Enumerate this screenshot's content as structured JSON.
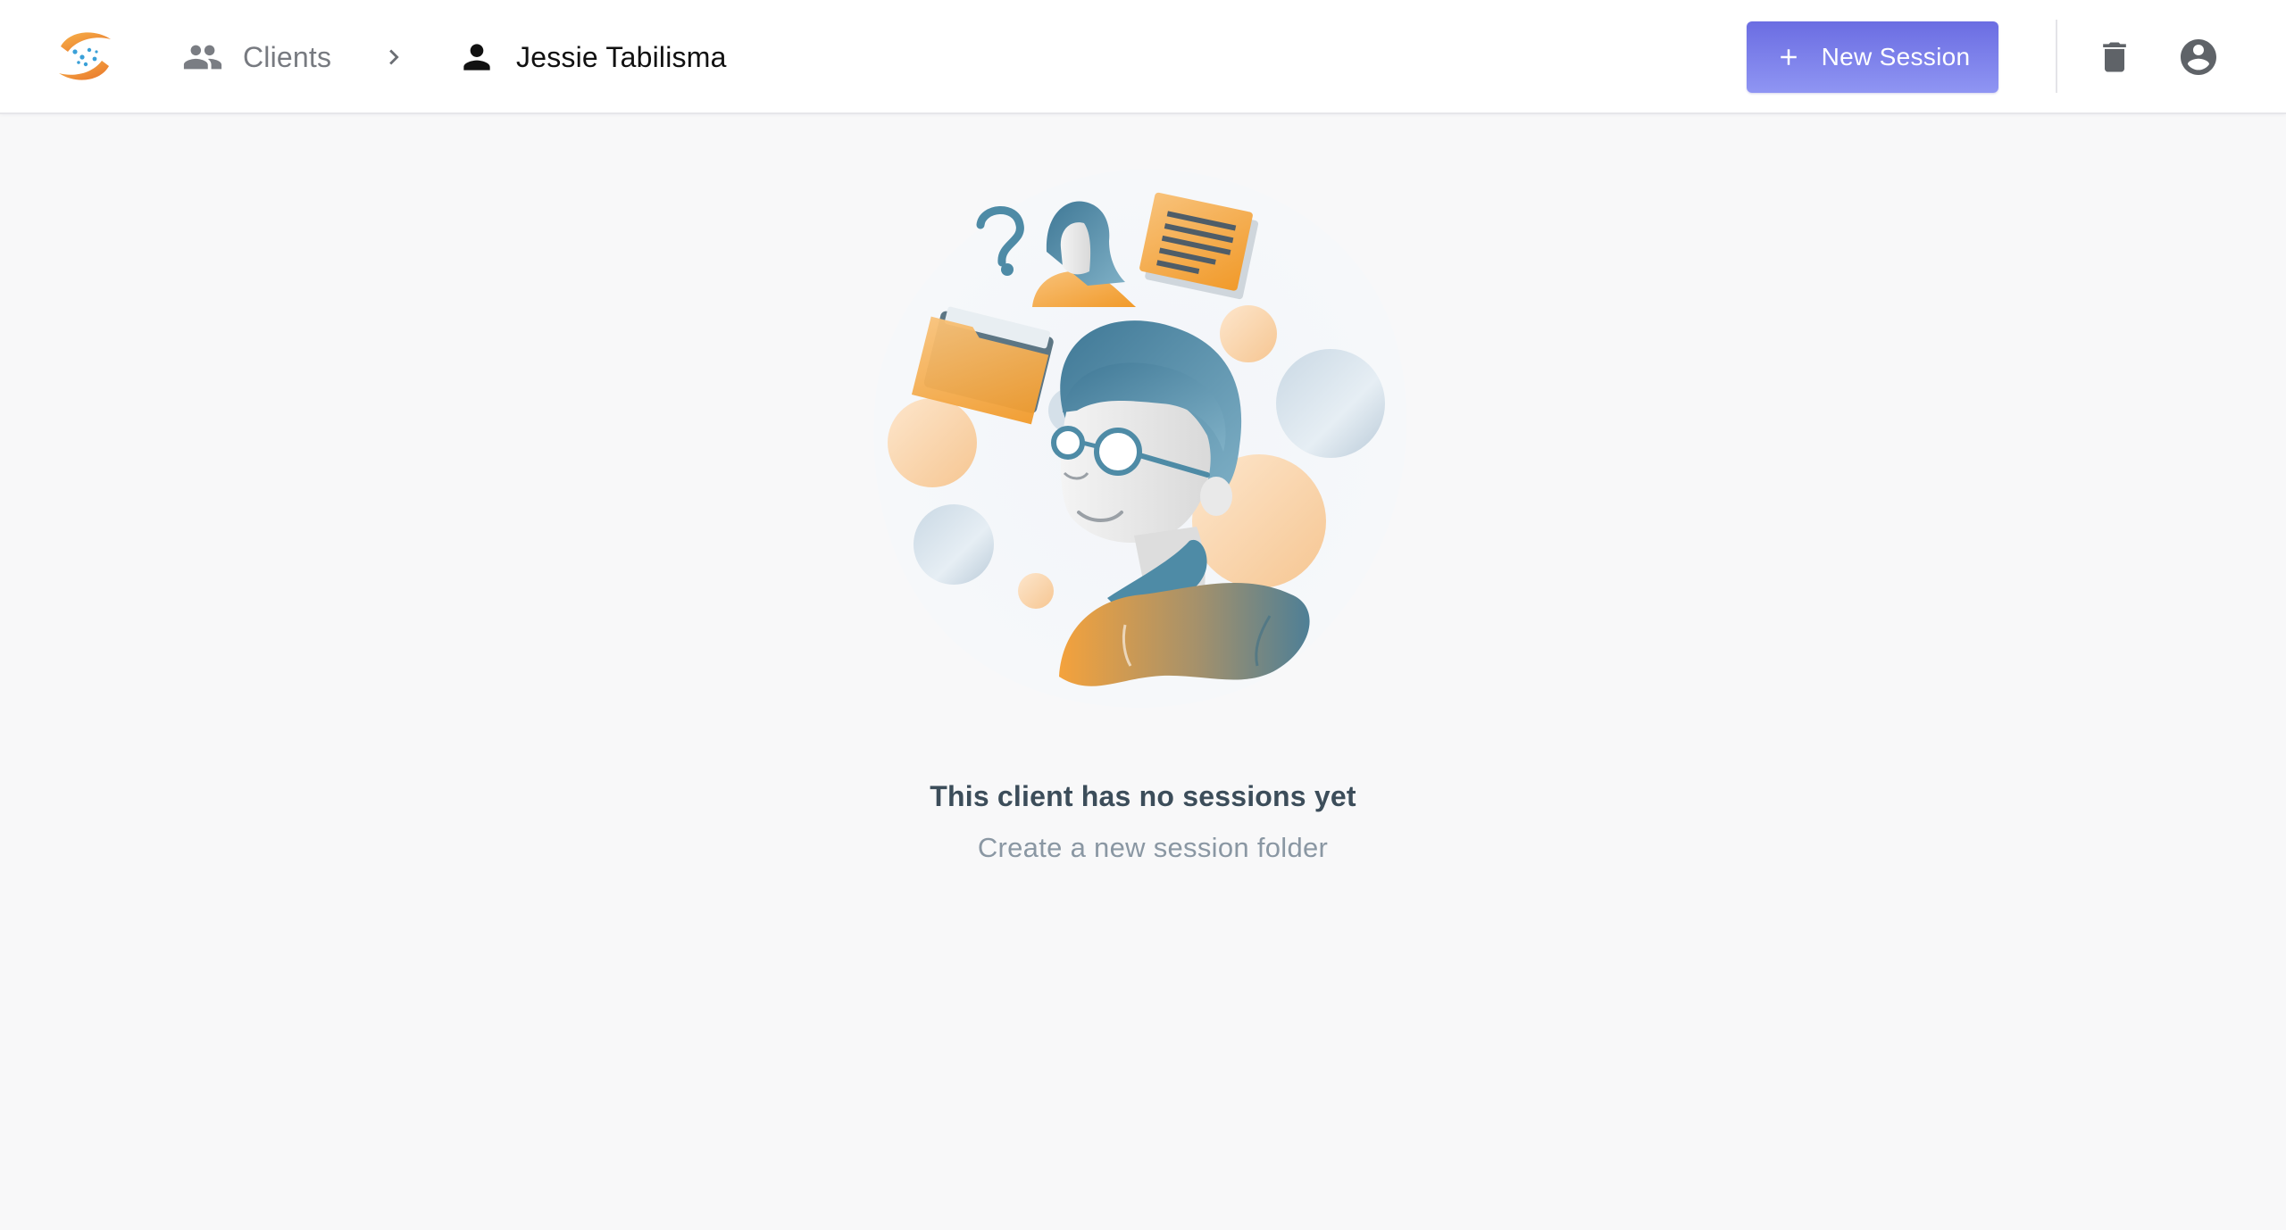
{
  "header": {
    "breadcrumb": {
      "clients_label": "Clients",
      "clients_icon": "people-icon",
      "separator_icon": "chevron-right-icon",
      "client_icon": "person-icon",
      "client_name": "Jessie Tabilisma"
    },
    "new_session_label": "New Session",
    "new_session_icon": "plus-icon",
    "delete_icon": "trash-icon",
    "account_icon": "account-circle-icon"
  },
  "empty_state": {
    "title": "This client has no sessions yet",
    "subtitle": "Create a new session folder"
  },
  "colors": {
    "accent": "#6b6de2",
    "accent_light": "#8f95f3",
    "illustration_orange": "#f4a23c",
    "illustration_teal": "#4e8ba6",
    "title_text": "#3c4d5a",
    "subtitle_text": "#8a97a3",
    "background": "#f8f8f9"
  }
}
